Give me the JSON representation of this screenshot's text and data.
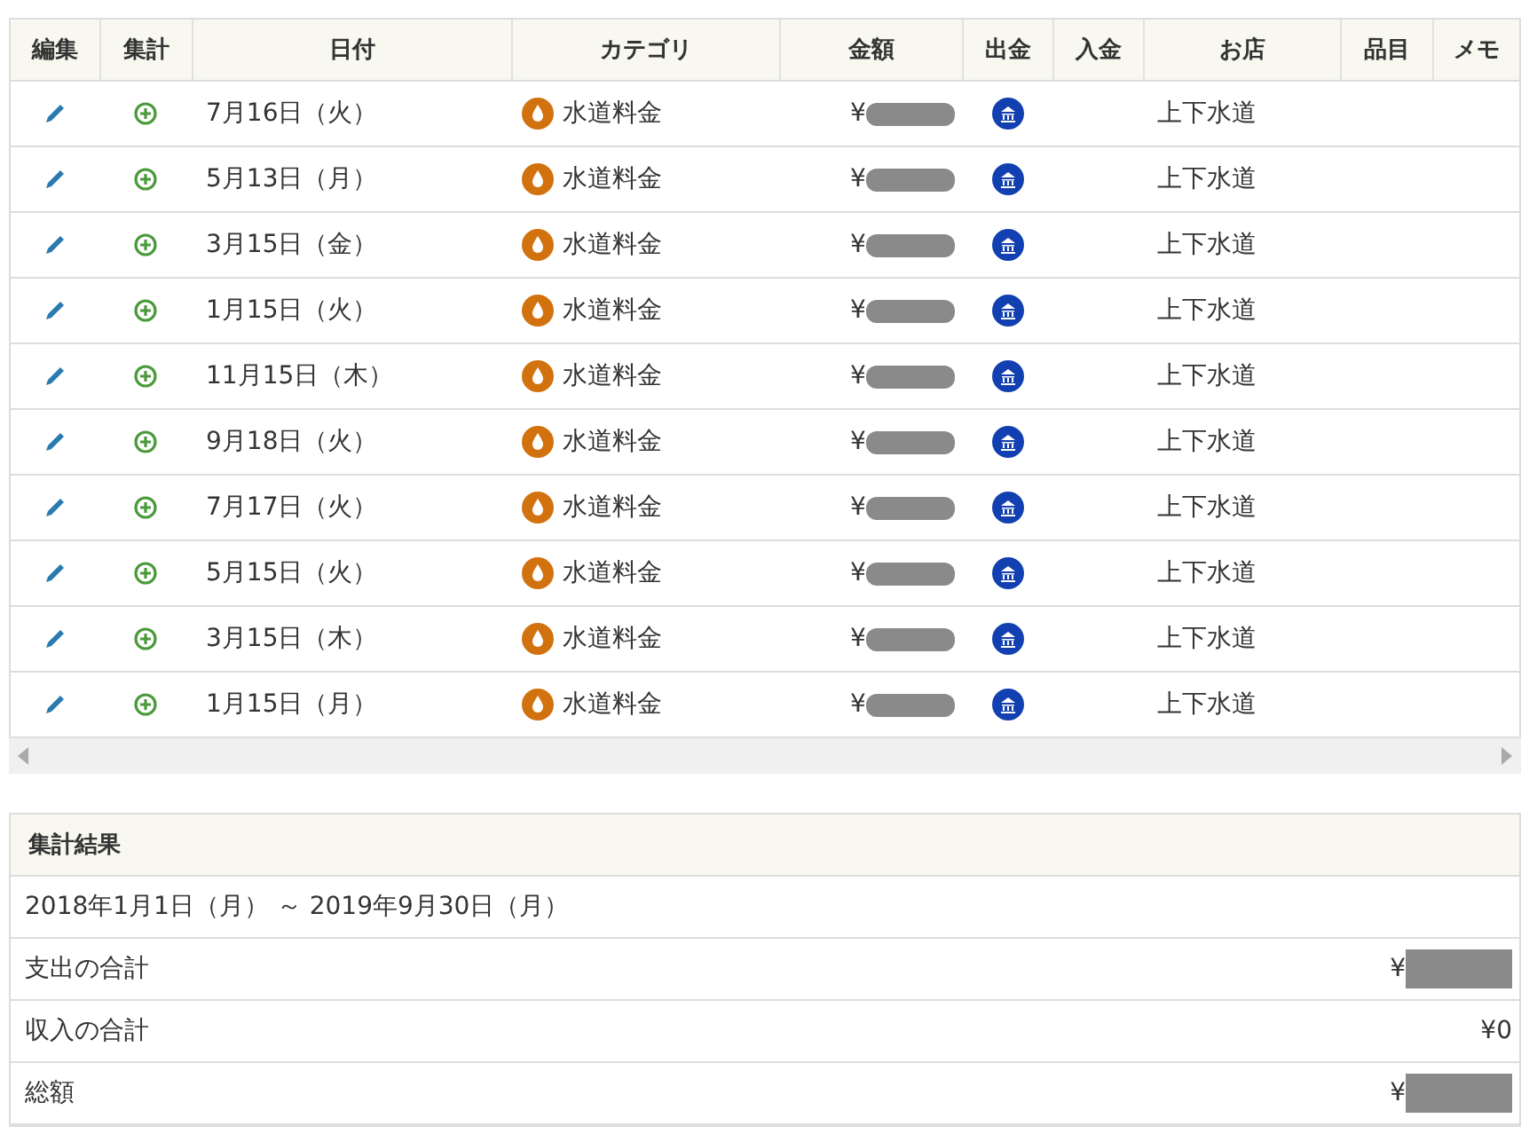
{
  "table": {
    "columns": [
      "編集",
      "集計",
      "日付",
      "カテゴリ",
      "金額",
      "出金",
      "入金",
      "お店",
      "品目",
      "メモ"
    ],
    "rows": [
      {
        "date": "7月16日（火）",
        "category": "水道料金",
        "amount": "¥",
        "amount_hidden": true,
        "kind": "expense",
        "store": "上下水道"
      },
      {
        "date": "5月13日（月）",
        "category": "水道料金",
        "amount": "¥",
        "amount_hidden": true,
        "kind": "expense",
        "store": "上下水道"
      },
      {
        "date": "3月15日（金）",
        "category": "水道料金",
        "amount": "¥",
        "amount_hidden": true,
        "kind": "expense",
        "store": "上下水道"
      },
      {
        "date": "1月15日（火）",
        "category": "水道料金",
        "amount": "¥",
        "amount_hidden": true,
        "kind": "expense",
        "store": "上下水道"
      },
      {
        "date": "11月15日（木）",
        "category": "水道料金",
        "amount": "¥",
        "amount_hidden": true,
        "kind": "expense",
        "store": "上下水道"
      },
      {
        "date": "9月18日（火）",
        "category": "水道料金",
        "amount": "¥",
        "amount_hidden": true,
        "kind": "expense",
        "store": "上下水道"
      },
      {
        "date": "7月17日（火）",
        "category": "水道料金",
        "amount": "¥",
        "amount_hidden": true,
        "kind": "expense",
        "store": "上下水道"
      },
      {
        "date": "5月15日（火）",
        "category": "水道料金",
        "amount": "¥",
        "amount_hidden": true,
        "kind": "expense",
        "store": "上下水道"
      },
      {
        "date": "3月15日（木）",
        "category": "水道料金",
        "amount": "¥",
        "amount_hidden": true,
        "kind": "expense",
        "store": "上下水道"
      },
      {
        "date": "1月15日（月）",
        "category": "水道料金",
        "amount": "¥",
        "amount_hidden": true,
        "kind": "expense",
        "store": "上下水道"
      }
    ]
  },
  "summary": {
    "title": "集計結果",
    "period": "2018年1月1日（月） ～ 2019年9月30日（月）",
    "rows": [
      {
        "label": "支出の合計",
        "value": "¥",
        "value_hidden": true
      },
      {
        "label": "収入の合計",
        "value": "¥0",
        "value_hidden": false
      },
      {
        "label": "総額",
        "value": "¥",
        "value_hidden": true
      }
    ]
  }
}
